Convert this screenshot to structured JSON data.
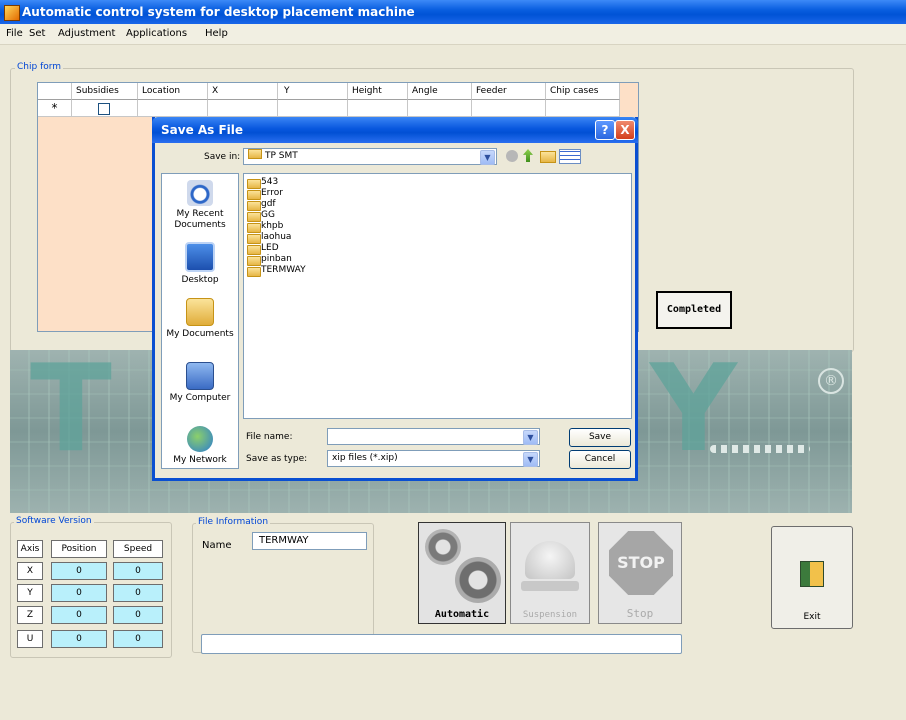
{
  "app": {
    "title": "Automatic control system for desktop placement machine"
  },
  "menu": [
    "File",
    "Set",
    "Adjustment",
    "Applications",
    "Help"
  ],
  "chip_form": {
    "label": "Chip form",
    "columns": [
      "Subsidies",
      "Location",
      "X",
      "Y",
      "Height",
      "Angle",
      "Feeder",
      "Chip cases"
    ],
    "new_row_marker": "*"
  },
  "completed_button": "Completed",
  "dialog": {
    "title": "Save As File",
    "save_in_label": "Save in:",
    "save_in_value": "TP SMT",
    "places": [
      "My Recent Documents",
      "Desktop",
      "My Documents",
      "My Computer",
      "My Network"
    ],
    "files": [
      "543",
      "Error",
      "gdf",
      "GG",
      "khpb",
      "laohua",
      "LED",
      "pinban",
      "TERMWAY"
    ],
    "file_name_label": "File name:",
    "file_name_value": "",
    "save_type_label": "Save as type:",
    "save_type_value": "xip files (*.xip)",
    "save_button": "Save",
    "cancel_button": "Cancel",
    "help_button": "?",
    "close_button": "X"
  },
  "banner": {
    "registered_mark": "®"
  },
  "software_version": {
    "label": "Software Version",
    "headers": [
      "Axis",
      "Position",
      "Speed"
    ],
    "rows": [
      {
        "axis": "X",
        "position": "0",
        "speed": "0"
      },
      {
        "axis": "Y",
        "position": "0",
        "speed": "0"
      },
      {
        "axis": "Z",
        "position": "0",
        "speed": "0"
      },
      {
        "axis": "U",
        "position": "0",
        "speed": "0"
      }
    ]
  },
  "file_info": {
    "label": "File Information",
    "name_label": "Name",
    "name_value": "TERMWAY"
  },
  "controls": {
    "automatic": "Automatic",
    "suspension": "Suspension",
    "stop": "Stop",
    "stop_sign": "STOP"
  },
  "exit_button": "Exit",
  "status_text": ""
}
